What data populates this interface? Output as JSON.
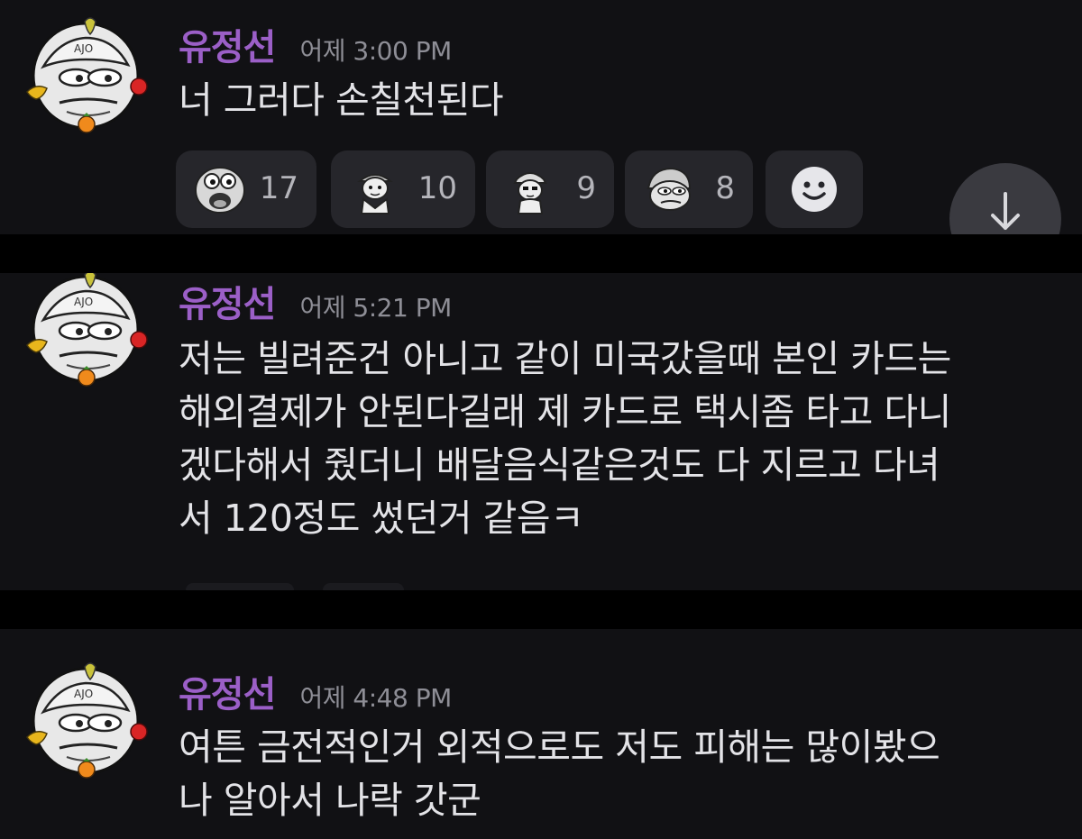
{
  "messages": [
    {
      "username": "유정선",
      "timestamp": "어제 3:00 PM",
      "text": "너 그러다 손칠천된다",
      "reactions": [
        {
          "emoji": "pepe-shocked-emoji",
          "count": "17"
        },
        {
          "emoji": "salute-man-emoji",
          "count": "10"
        },
        {
          "emoji": "cap-man-emoji",
          "count": "9"
        },
        {
          "emoji": "pepe-helmet-emoji",
          "count": "8"
        }
      ],
      "add_reaction_icon": "smiley-add-reaction-icon"
    },
    {
      "username": "유정선",
      "timestamp": "어제 5:21 PM",
      "text_lines": [
        "저는 빌려준건 아니고 같이 미국갔을때 본인 카드는",
        "해외결제가 안된다길래 제 카드로 택시좀 타고 다니",
        "겠다해서 줬더니 배달음식같은것도 다 지르고 다녀",
        "서 120정도 썼던거 같음ㅋ"
      ]
    },
    {
      "username": "유정선",
      "timestamp": "어제 4:48 PM",
      "text_lines": [
        "여튼 금전적인거 외적으로도 저도 피해는 많이봤으",
        "나 알아서 나락 갓군"
      ]
    }
  ],
  "scroll_button": {
    "icon": "arrow-down-icon"
  },
  "avatar": {
    "badge_text": "AJO"
  },
  "colors": {
    "background": "#111114",
    "username": "#9b5fc7",
    "timestamp": "#8e8e96",
    "message_text": "#e3e3e7",
    "reaction_bg": "#26262b"
  }
}
